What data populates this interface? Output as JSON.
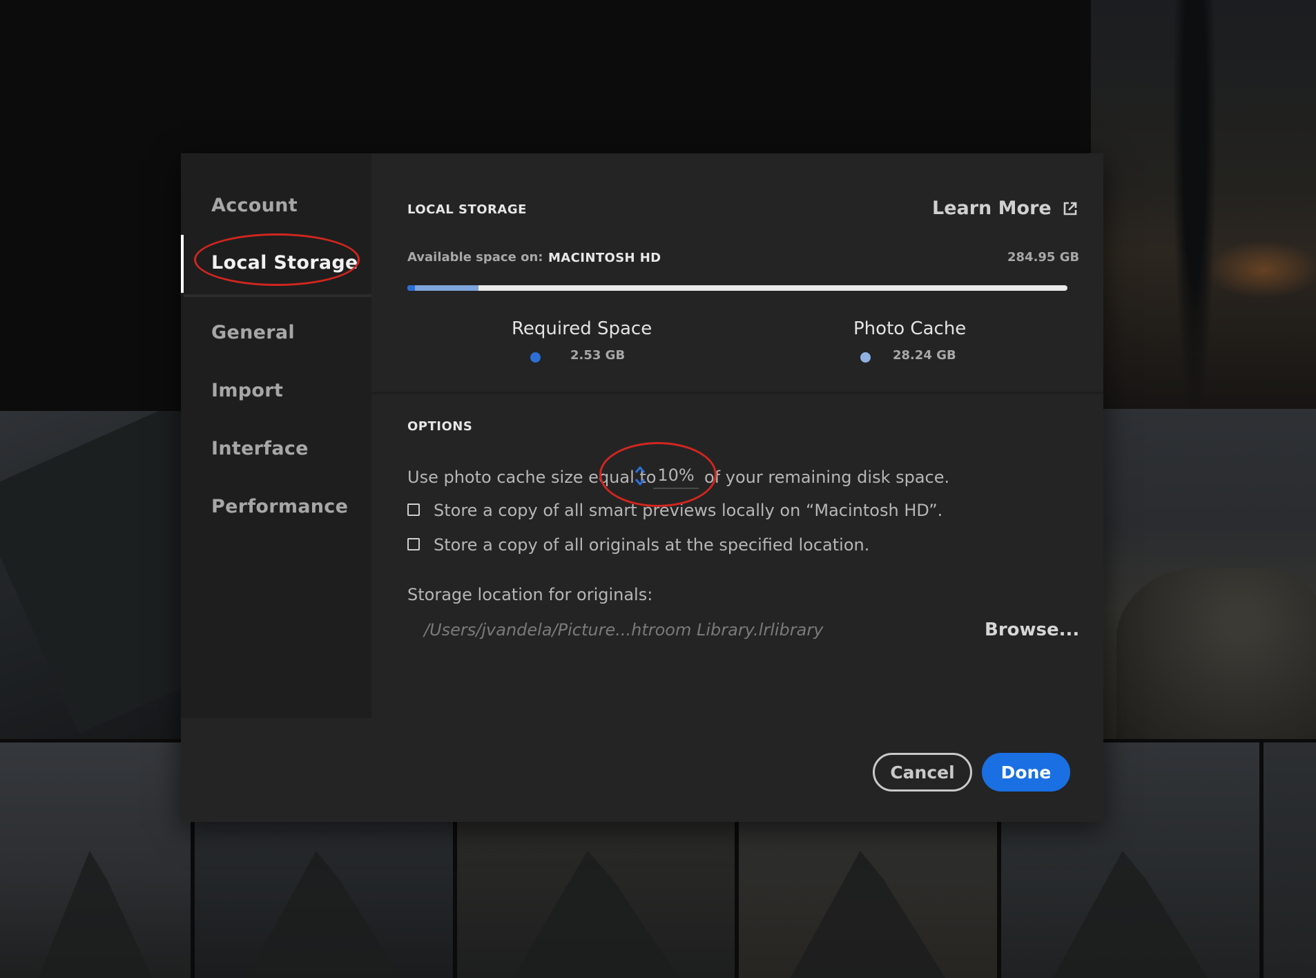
{
  "sidebar": {
    "items": [
      {
        "label": "Account"
      },
      {
        "label": "Local Storage",
        "active": true
      },
      {
        "label": "General"
      },
      {
        "label": "Import"
      },
      {
        "label": "Interface"
      },
      {
        "label": "Performance"
      }
    ]
  },
  "storage": {
    "section_title": "LOCAL STORAGE",
    "learn_more_label": "Learn More",
    "available_label": "Available space on:",
    "drive_name": "MACINTOSH HD",
    "available_size": "284.95 GB",
    "required_fraction": 0.011,
    "cache_fraction": 0.108,
    "required_title": "Required Space",
    "required_value": "2.53 GB",
    "cache_title": "Photo Cache",
    "cache_value": "28.24 GB"
  },
  "options": {
    "section_title": "OPTIONS",
    "cache_text_before": "Use photo cache size equal to",
    "cache_percent": "10%",
    "cache_text_after": "of your remaining disk space.",
    "smart_previews_label": "Store a copy of all smart previews locally on “Macintosh HD”.",
    "originals_label": "Store a copy of all originals at the specified location.",
    "storage_location_label": "Storage location for originals:",
    "storage_path": "/Users/jvandela/Picture...htroom Library.lrlibrary",
    "browse_label": "Browse..."
  },
  "buttons": {
    "cancel_label": "Cancel",
    "done_label": "Done"
  },
  "colors": {
    "accent": "#1a6fe3",
    "required_dot": "#2d6fd6",
    "cache_dot": "#8fb2e3",
    "annotation": "#d2261f"
  }
}
